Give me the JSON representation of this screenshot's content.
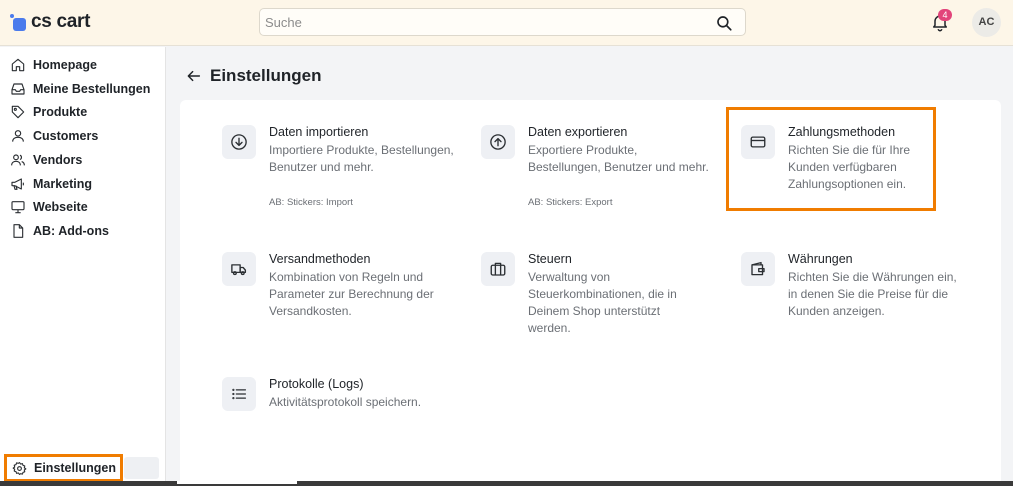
{
  "app": {
    "logo_text": "cs cart",
    "brand_color": "#4b7bec"
  },
  "header": {
    "search_placeholder": "Suche",
    "notifications_count": "4",
    "avatar_initials": "AC"
  },
  "sidebar": {
    "items": [
      {
        "label": "Homepage",
        "icon": "home-icon"
      },
      {
        "label": "Meine Bestellungen",
        "icon": "inbox-icon"
      },
      {
        "label": "Produkte",
        "icon": "tag-icon"
      },
      {
        "label": "Customers",
        "icon": "user-icon"
      },
      {
        "label": "Vendors",
        "icon": "users-icon"
      },
      {
        "label": "Marketing",
        "icon": "megaphone-icon"
      },
      {
        "label": "Webseite",
        "icon": "monitor-icon"
      },
      {
        "label": "AB: Add-ons",
        "icon": "file-icon"
      }
    ],
    "settings_label": "Einstellungen"
  },
  "page": {
    "title": "Einstellungen"
  },
  "cards": [
    {
      "title": "Daten importieren",
      "desc": "Importiere Produkte, Bestellungen, Benutzer und mehr.",
      "sub": "AB: Stickers: Import",
      "icon": "download-circle-icon"
    },
    {
      "title": "Daten exportieren",
      "desc": "Exportiere Produkte, Bestellungen, Benutzer und mehr.",
      "sub": "AB: Stickers: Export",
      "icon": "upload-circle-icon"
    },
    {
      "title": "Zahlungsmethoden",
      "desc": "Richten Sie die für Ihre Kunden verfügbaren Zahlungsoptionen ein.",
      "icon": "credit-card-icon"
    },
    {
      "title": "Versandmethoden",
      "desc": "Kombination von Regeln und Parameter zur Berechnung der Versandkosten.",
      "icon": "truck-icon"
    },
    {
      "title": "Steuern",
      "desc": "Verwaltung von Steuerkombinationen, die in Deinem Shop unterstützt werden.",
      "icon": "briefcase-icon"
    },
    {
      "title": "Währungen",
      "desc": "Richten Sie die Währungen ein, in denen Sie die Preise für die Kunden anzeigen.",
      "icon": "wallet-icon"
    },
    {
      "title": "Protokolle (Logs)",
      "desc": "Aktivitätsprotokoll speichern.",
      "icon": "list-icon"
    }
  ],
  "highlight_color": "#f07c00"
}
